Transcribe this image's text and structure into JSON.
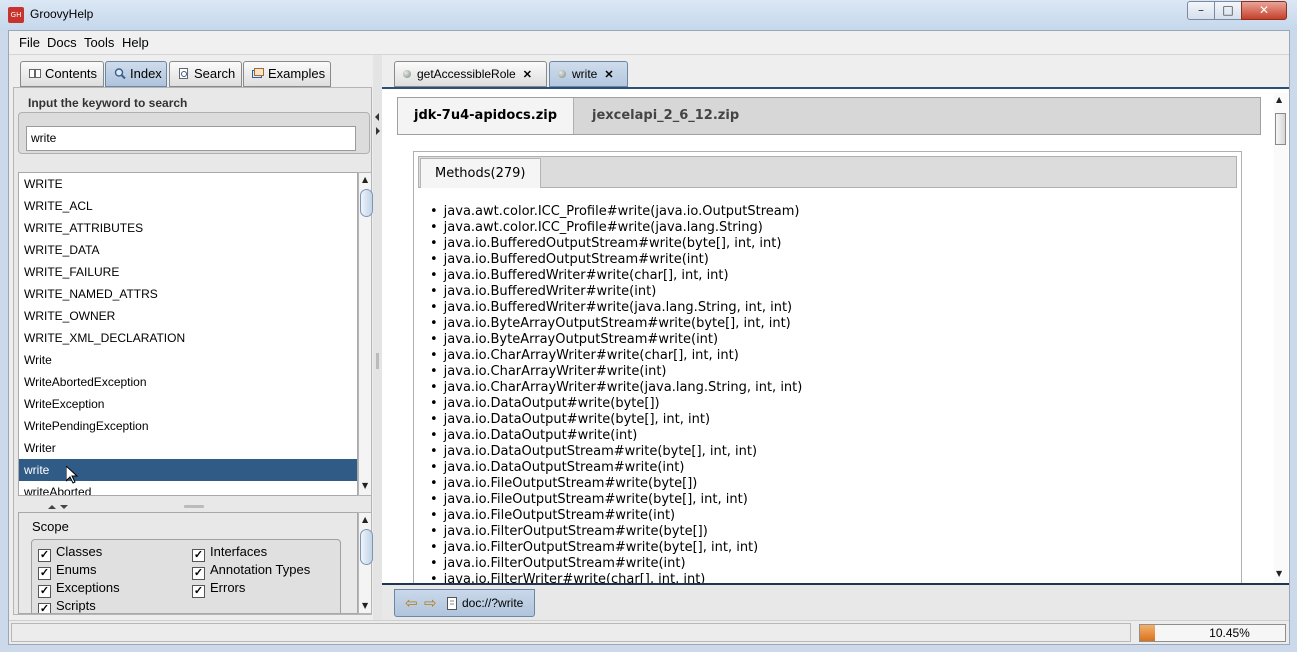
{
  "window": {
    "title": "GroovyHelp",
    "app_icon": "GH",
    "min": "–",
    "max": "□",
    "close": "✕"
  },
  "menu": [
    "File",
    "Docs",
    "Tools",
    "Help"
  ],
  "left_tabs": [
    {
      "label": "Contents",
      "icon": "book-icon"
    },
    {
      "label": "Index",
      "icon": "magnifier-icon",
      "active": true
    },
    {
      "label": "Search",
      "icon": "search-page-icon"
    },
    {
      "label": "Examples",
      "icon": "examples-icon"
    }
  ],
  "search": {
    "label": "Input the keyword to search",
    "value": "write"
  },
  "index_list": [
    "WRITE",
    "WRITE_ACL",
    "WRITE_ATTRIBUTES",
    "WRITE_DATA",
    "WRITE_FAILURE",
    "WRITE_NAMED_ATTRS",
    "WRITE_OWNER",
    "WRITE_XML_DECLARATION",
    "Write",
    "WriteAbortedException",
    "WriteException",
    "WritePendingException",
    "Writer",
    "write",
    "writeAborted"
  ],
  "selected_index": 13,
  "scope": {
    "title": "Scope",
    "options": [
      {
        "label": "Classes",
        "checked": true
      },
      {
        "label": "Interfaces",
        "checked": true
      },
      {
        "label": "Enums",
        "checked": true
      },
      {
        "label": "Annotation Types",
        "checked": true
      },
      {
        "label": "Exceptions",
        "checked": true
      },
      {
        "label": "Errors",
        "checked": true
      },
      {
        "label": "Scripts",
        "checked": true
      }
    ]
  },
  "doc_tabs": [
    {
      "label": "getAccessibleRole",
      "close": "✕"
    },
    {
      "label": "write",
      "close": "✕",
      "active": true
    }
  ],
  "zip_tabs": [
    "jdk-7u4-apidocs.zip",
    "jexcelapi_2_6_12.zip"
  ],
  "methods_tab": "Methods(279)",
  "methods": [
    "java.awt.color.ICC_Profile#write(java.io.OutputStream)",
    "java.awt.color.ICC_Profile#write(java.lang.String)",
    "java.io.BufferedOutputStream#write(byte[], int, int)",
    "java.io.BufferedOutputStream#write(int)",
    "java.io.BufferedWriter#write(char[], int, int)",
    "java.io.BufferedWriter#write(int)",
    "java.io.BufferedWriter#write(java.lang.String, int, int)",
    "java.io.ByteArrayOutputStream#write(byte[], int, int)",
    "java.io.ByteArrayOutputStream#write(int)",
    "java.io.CharArrayWriter#write(char[], int, int)",
    "java.io.CharArrayWriter#write(int)",
    "java.io.CharArrayWriter#write(java.lang.String, int, int)",
    "java.io.DataOutput#write(byte[])",
    "java.io.DataOutput#write(byte[], int, int)",
    "java.io.DataOutput#write(int)",
    "java.io.DataOutputStream#write(byte[], int, int)",
    "java.io.DataOutputStream#write(int)",
    "java.io.FileOutputStream#write(byte[])",
    "java.io.FileOutputStream#write(byte[], int, int)",
    "java.io.FileOutputStream#write(int)",
    "java.io.FilterOutputStream#write(byte[])",
    "java.io.FilterOutputStream#write(byte[], int, int)",
    "java.io.FilterOutputStream#write(int)",
    "java.io.FilterWriter#write(char[], int, int)"
  ],
  "nav": {
    "back": "⇦",
    "forward": "⇨",
    "address": "doc://?write"
  },
  "status": {
    "text": "",
    "progress_percent": 10.45,
    "progress_label": "10.45%"
  },
  "colors": {
    "selection": "#2f5b86",
    "progress": "#d8731e",
    "accent": "#2b4f77"
  }
}
